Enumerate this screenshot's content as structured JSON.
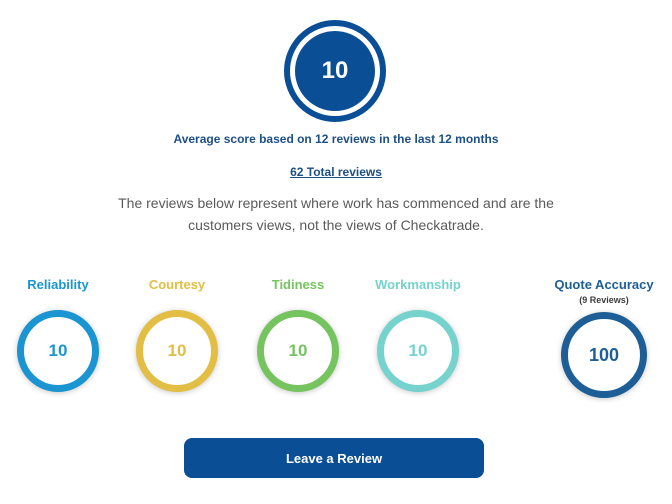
{
  "summary": {
    "score": "10",
    "average_text": "Average score based on 12 reviews in the last 12 months",
    "total_reviews_link": "62 Total reviews",
    "disclaimer": "The reviews below represent where work has commenced and are the customers views, not the views of Checkatrade."
  },
  "categories": [
    {
      "label": "Reliability",
      "value": "10",
      "color": "#1b95d1"
    },
    {
      "label": "Courtesy",
      "value": "10",
      "color": "#e2be44"
    },
    {
      "label": "Tidiness",
      "value": "10",
      "color": "#76c45f"
    },
    {
      "label": "Workmanship",
      "value": "10",
      "color": "#76d2cc"
    }
  ],
  "quote_accuracy": {
    "label": "Quote Accuracy",
    "sublabel": "(9 Reviews)",
    "value": "100",
    "color": "#1d5e96"
  },
  "colors": {
    "brand_blue": "#0a4e96",
    "heading_blue": "#1d4f87"
  },
  "actions": {
    "leave_review_label": "Leave a Review"
  }
}
